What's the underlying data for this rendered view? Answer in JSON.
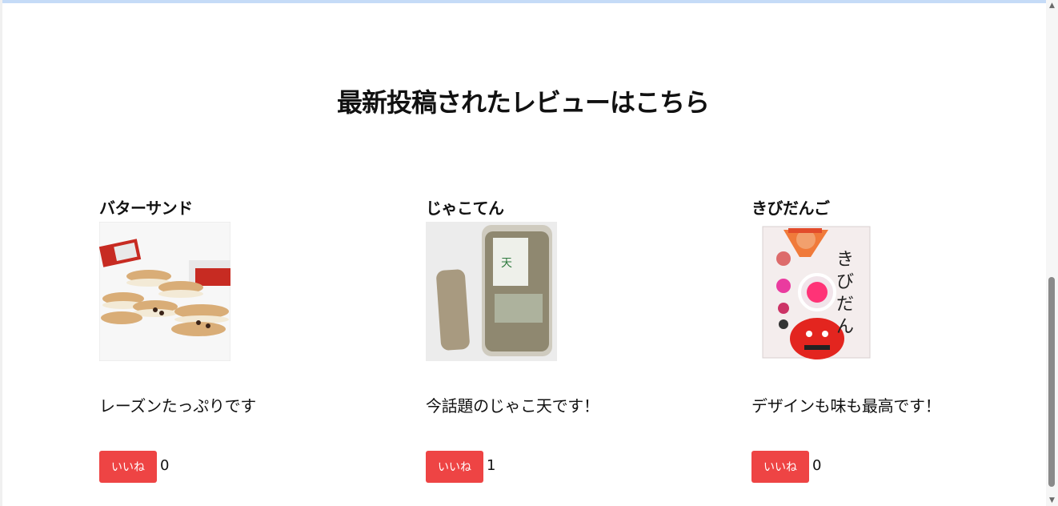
{
  "page": {
    "heading": "最新投稿されたレビューはこちら"
  },
  "reviews": [
    {
      "title": "バターサンド",
      "comment": "レーズンたっぷりです",
      "like_label": "いいね",
      "like_count": "0"
    },
    {
      "title": "じゃこてん",
      "comment": "今話題のじゃこ天です！",
      "like_label": "いいね",
      "like_count": "1"
    },
    {
      "title": "きびだんご",
      "comment": "デザインも味も最高です！",
      "like_label": "いいね",
      "like_count": "0"
    }
  ],
  "colors": {
    "like_button": "#ee4444",
    "top_bar": "#c5dbf7",
    "scrollbar_thumb": "#8a8a8a"
  },
  "icons": {
    "scroll_up": "triangle-up-icon",
    "scroll_down": "triangle-down-icon"
  },
  "scrollbar": {
    "position_fraction": 0.55
  }
}
